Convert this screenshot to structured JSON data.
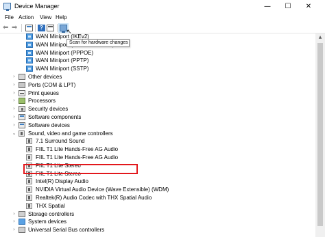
{
  "window": {
    "title": "Device Manager",
    "minimize_glyph": "—",
    "maximize_glyph": "☐",
    "close_glyph": "✕"
  },
  "menu": [
    "File",
    "Action",
    "View",
    "Help"
  ],
  "toolbar": {
    "back_glyph": "⬅",
    "forward_glyph": "➡",
    "help_glyph": "?",
    "icons": [
      "back-icon",
      "forward-icon",
      "properties-icon",
      "help-icon",
      "update-driver-icon",
      "scan-hardware-icon"
    ]
  },
  "tooltip": "Scan for hardware changes",
  "tree": {
    "network_children": [
      "WAN Miniport (IKEv2)",
      "WAN Miniport (Network Monitor)",
      "WAN Miniport (PPPOE)",
      "WAN Miniport (PPTP)",
      "WAN Miniport (SSTP)"
    ],
    "categories_a": [
      {
        "label": "Other devices",
        "icon": "generic"
      },
      {
        "label": "Ports (COM & LPT)",
        "icon": "port"
      },
      {
        "label": "Print queues",
        "icon": "printer"
      },
      {
        "label": "Processors",
        "icon": "cpu"
      },
      {
        "label": "Security devices",
        "icon": "security"
      },
      {
        "label": "Software components",
        "icon": "software"
      },
      {
        "label": "Software devices",
        "icon": "software"
      }
    ],
    "sound_category": "Sound, video and game controllers",
    "sound_children": [
      "7.1 Surround Sound",
      "FIIL T1 Lite Hands-Free AG Audio",
      "FIIL T1 Lite Hands-Free AG Audio",
      "FIIL T1 Lite Stereo",
      "FIIL T1 Lite Stereo",
      "Intel(R) Display Audio",
      "NVIDIA Virtual Audio Device (Wave Extensible) (WDM)",
      "Realtek(R) Audio Codec with THX Spatial Audio",
      "THX Spatial"
    ],
    "categories_b": [
      {
        "label": "Storage controllers",
        "icon": "storage"
      },
      {
        "label": "System devices",
        "icon": "system"
      },
      {
        "label": "Universal Serial Bus controllers",
        "icon": "usb"
      }
    ],
    "collapsed_glyph": "›",
    "expanded_glyph": "⌄",
    "highlighted_item": "Realtek(R) Audio Codec with THX Spatial Audio"
  },
  "scrollbar": {
    "up_glyph": "▲"
  },
  "colors": {
    "highlight_border": "#e2181c",
    "accent_blue": "#2e6fbd"
  }
}
